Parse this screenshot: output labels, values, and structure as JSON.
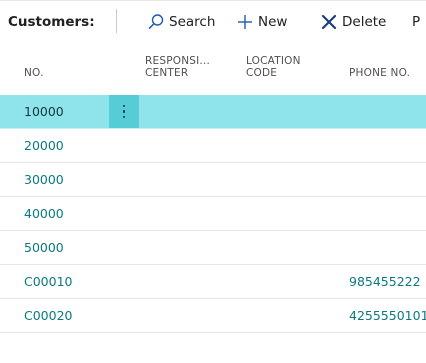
{
  "actionbar": {
    "caption": "Customers:",
    "search_label": "Search",
    "new_label": "New",
    "delete_label": "Delete",
    "more_label": "P"
  },
  "columns": {
    "no": "NO.",
    "responsibility_center": "RESPONSI... CENTER",
    "location_code": "LOCATION CODE",
    "phone_no": "PHONE NO."
  },
  "rows": [
    {
      "no": "10000",
      "phone": ""
    },
    {
      "no": "20000",
      "phone": ""
    },
    {
      "no": "30000",
      "phone": ""
    },
    {
      "no": "40000",
      "phone": ""
    },
    {
      "no": "50000",
      "phone": ""
    },
    {
      "no": "C00010",
      "phone": "985455222"
    },
    {
      "no": "C00020",
      "phone": "4255550101"
    }
  ],
  "selected_row": "10000",
  "colors": {
    "selected_row": "#8fe3ea",
    "row_menu": "#56cdd6",
    "link_text": "#0a7a80",
    "delete_icon": "#1b3f7a"
  },
  "icons": {
    "search": "search-icon",
    "new": "plus-icon",
    "delete": "x-icon",
    "row_menu": "vertical-ellipsis-icon"
  }
}
